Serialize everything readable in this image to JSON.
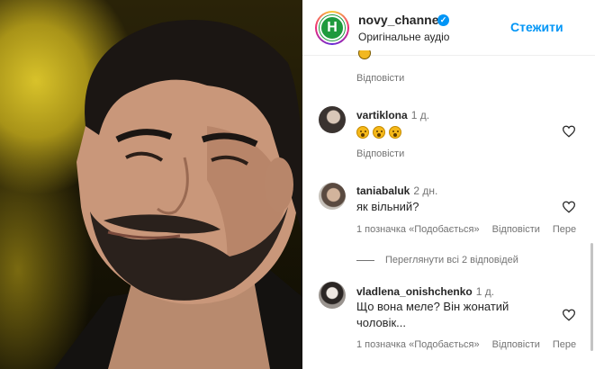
{
  "header": {
    "avatar_letter": "H",
    "username": "novy_channel",
    "verified_icon": "verified-badge-icon",
    "audio_label": "Оригінальне аудіо",
    "follow_label": "Стежити"
  },
  "colors": {
    "accent": "#0095f6",
    "logo_green": "#1f9a3d",
    "muted_text": "#737373"
  },
  "top_reply_label": "Відповісти",
  "comments": [
    {
      "username": "vartiklona",
      "time": "1 д.",
      "emoji_icons": [
        "hushed-face-emoji",
        "hushed-face-emoji",
        "hushed-face-emoji"
      ],
      "reply_label": "Відповісти"
    },
    {
      "username": "taniabaluk",
      "time": "2 дн.",
      "text": "як вільний?",
      "likes_label": "1 позначка «Подобається»",
      "reply_label": "Відповісти",
      "more_label": "Пере"
    },
    {
      "username": "vladlena_onishchenko",
      "time": "1 д.",
      "text_line1": "Що вона меле? Він жонатий",
      "text_line2": "чоловік...",
      "likes_label": "1 позначка «Подобається»",
      "reply_label": "Відповісти",
      "more_label": "Пере"
    }
  ],
  "view_replies_label": "Переглянути всі 2 відповідей"
}
